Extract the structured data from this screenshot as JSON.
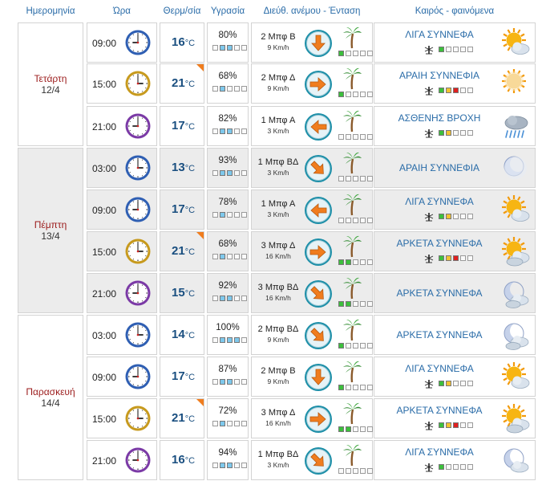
{
  "headers": {
    "date": "Ημερομηνία",
    "time": "Ώρα",
    "temp": "Θερμ/σία",
    "humidity": "Υγρασία",
    "wind": "Διεύθ. ανέμου - Ένταση",
    "weather": "Καιρός - φαινόμενα"
  },
  "temp_unit": "°C",
  "colors": {
    "header_text": "#2a6ca8",
    "day_name": "#9b1b1b",
    "temp": "#1a4f80",
    "weather_text": "#2a6ca8",
    "hot_flag": "#f07d1e"
  },
  "days": [
    {
      "name": "Τετάρτη",
      "date": "12/4"
    },
    {
      "name": "Πέμπτη",
      "date": "13/4"
    },
    {
      "name": "Παρασκευή",
      "date": "14/4"
    }
  ],
  "rows": [
    {
      "time": "09:00",
      "clock": "blue",
      "temp": "16",
      "hot": false,
      "humidity": "80%",
      "hum_bars": [
        1,
        2
      ],
      "wind_force": "2 Μπφ Β",
      "wind_speed": "9 Km/h",
      "wind_arrow": "down",
      "wind_bars": [
        "green"
      ],
      "weather": "ΛΙΓΑ ΣΥΝΝΕΦΑ",
      "mosquito": true,
      "mosq_level": [
        "green"
      ],
      "weather_icon": "sun-cloud-icon"
    },
    {
      "time": "15:00",
      "clock": "gold",
      "temp": "21",
      "hot": true,
      "humidity": "68%",
      "hum_bars": [
        1
      ],
      "wind_force": "2 Μπφ Δ",
      "wind_speed": "9 Km/h",
      "wind_arrow": "right",
      "wind_bars": [
        "green"
      ],
      "weather": "ΑΡΑΙΗ ΣΥΝΝΕΦΙΑ",
      "mosquito": true,
      "mosq_level": [
        "green",
        "yellow",
        "red"
      ],
      "weather_icon": "sun-haze-icon"
    },
    {
      "time": "21:00",
      "clock": "purple",
      "temp": "17",
      "hot": false,
      "humidity": "82%",
      "hum_bars": [
        1,
        2
      ],
      "wind_force": "1 Μπφ Α",
      "wind_speed": "3 Km/h",
      "wind_arrow": "left",
      "wind_bars": [],
      "weather": "ΑΣΘΕΝΗΣ ΒΡΟΧΗ",
      "mosquito": true,
      "mosq_level": [
        "green",
        "yellow"
      ],
      "weather_icon": "rain-cloud-icon"
    },
    {
      "time": "03:00",
      "clock": "blue",
      "temp": "13",
      "hot": false,
      "humidity": "93%",
      "hum_bars": [
        1,
        2
      ],
      "wind_force": "1 Μπφ ΒΔ",
      "wind_speed": "3 Km/h",
      "wind_arrow": "down-right",
      "wind_bars": [],
      "weather": "ΑΡΑΙΗ ΣΥΝΝΕΦΙΑ",
      "mosquito": false,
      "mosq_level": [],
      "weather_icon": "moon-haze-icon"
    },
    {
      "time": "09:00",
      "clock": "blue",
      "temp": "17",
      "hot": false,
      "humidity": "78%",
      "hum_bars": [
        1
      ],
      "wind_force": "1 Μπφ Α",
      "wind_speed": "3 Km/h",
      "wind_arrow": "left",
      "wind_bars": [],
      "weather": "ΛΙΓΑ ΣΥΝΝΕΦΑ",
      "mosquito": true,
      "mosq_level": [
        "green",
        "yellow"
      ],
      "weather_icon": "sun-cloud-icon"
    },
    {
      "time": "15:00",
      "clock": "gold",
      "temp": "21",
      "hot": true,
      "humidity": "68%",
      "hum_bars": [
        1
      ],
      "wind_force": "3 Μπφ Δ",
      "wind_speed": "16 Km/h",
      "wind_arrow": "right",
      "wind_bars": [
        "green",
        "green"
      ],
      "weather": "ΑΡΚΕΤΑ ΣΥΝΝΕΦΑ",
      "mosquito": true,
      "mosq_level": [
        "green",
        "yellow",
        "red"
      ],
      "weather_icon": "sun-clouds-icon"
    },
    {
      "time": "21:00",
      "clock": "purple",
      "temp": "15",
      "hot": false,
      "humidity": "92%",
      "hum_bars": [
        1,
        2
      ],
      "wind_force": "3 Μπφ ΒΔ",
      "wind_speed": "16 Km/h",
      "wind_arrow": "down-right",
      "wind_bars": [
        "green",
        "green"
      ],
      "weather": "ΑΡΚΕΤΑ ΣΥΝΝΕΦΑ",
      "mosquito": false,
      "mosq_level": [],
      "weather_icon": "moon-clouds-icon"
    },
    {
      "time": "03:00",
      "clock": "blue",
      "temp": "14",
      "hot": false,
      "humidity": "100%",
      "hum_bars": [
        1,
        2,
        3
      ],
      "wind_force": "2 Μπφ ΒΔ",
      "wind_speed": "9 Km/h",
      "wind_arrow": "down-right",
      "wind_bars": [
        "green"
      ],
      "weather": "ΑΡΚΕΤΑ ΣΥΝΝΕΦΑ",
      "mosquito": false,
      "mosq_level": [],
      "weather_icon": "moon-clouds-icon"
    },
    {
      "time": "09:00",
      "clock": "blue",
      "temp": "17",
      "hot": false,
      "humidity": "87%",
      "hum_bars": [
        1,
        2
      ],
      "wind_force": "2 Μπφ Β",
      "wind_speed": "9 Km/h",
      "wind_arrow": "down",
      "wind_bars": [
        "green"
      ],
      "weather": "ΛΙΓΑ ΣΥΝΝΕΦΑ",
      "mosquito": true,
      "mosq_level": [
        "green",
        "yellow"
      ],
      "weather_icon": "sun-cloud-icon"
    },
    {
      "time": "15:00",
      "clock": "gold",
      "temp": "21",
      "hot": true,
      "humidity": "72%",
      "hum_bars": [
        1
      ],
      "wind_force": "3 Μπφ Δ",
      "wind_speed": "16 Km/h",
      "wind_arrow": "right",
      "wind_bars": [
        "green",
        "green"
      ],
      "weather": "ΑΡΚΕΤΑ ΣΥΝΝΕΦΑ",
      "mosquito": true,
      "mosq_level": [
        "green",
        "yellow",
        "red"
      ],
      "weather_icon": "sun-clouds-icon"
    },
    {
      "time": "21:00",
      "clock": "purple",
      "temp": "16",
      "hot": false,
      "humidity": "94%",
      "hum_bars": [
        1,
        2
      ],
      "wind_force": "1 Μπφ ΒΔ",
      "wind_speed": "3 Km/h",
      "wind_arrow": "down-right",
      "wind_bars": [],
      "weather": "ΛΙΓΑ ΣΥΝΝΕΦΑ",
      "mosquito": true,
      "mosq_level": [
        "green"
      ],
      "weather_icon": "moon-cloud-icon"
    }
  ]
}
